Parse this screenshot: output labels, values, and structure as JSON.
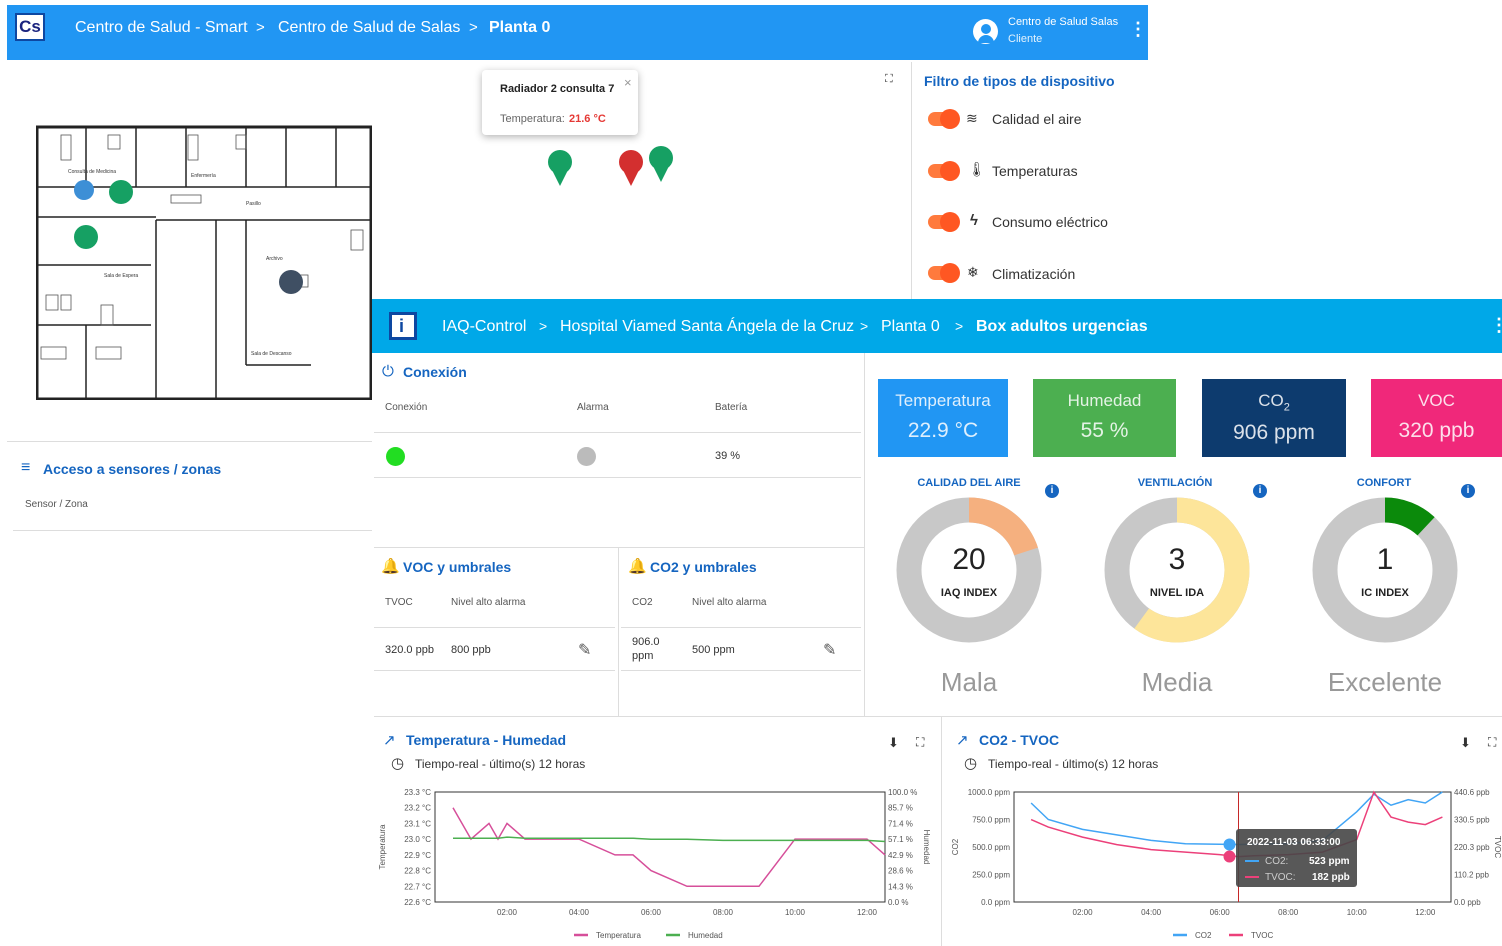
{
  "bg_app": {
    "logo": "Cs",
    "breadcrumbs": [
      "Centro de Salud - Smart",
      "Centro de Salud de Salas",
      "Planta 0"
    ],
    "separator": ">",
    "user_name": "Centro de Salud Salas",
    "user_role": "Cliente",
    "popup": {
      "title": "Radiador 2 consulta 7",
      "temp_label": "Temperatura:",
      "temp_value": "21.6 °C",
      "close": "×"
    },
    "filter_title": "Filtro de tipos de dispositivo",
    "filters": [
      {
        "label": "Calidad el aire",
        "icon": "wind-icon",
        "glyph": "≋"
      },
      {
        "label": "Temperaturas",
        "icon": "thermometer-icon",
        "glyph": "🌡"
      },
      {
        "label": "Consumo eléctrico",
        "icon": "lightning-icon",
        "glyph": "ϟ"
      },
      {
        "label": "Climatización",
        "icon": "snowflake-icon",
        "glyph": "❄"
      }
    ],
    "access_title": "Acceso a sensores / zonas",
    "access_sub": "Sensor / Zona"
  },
  "app": {
    "logo": "i",
    "breadcrumbs": [
      "IAQ-Control",
      "Hospital Viamed Santa Ángela de la Cruz",
      "Planta 0",
      "Box adultos urgencias"
    ],
    "separator": ">",
    "connection": {
      "title": "Conexión",
      "headers": [
        "Conexión",
        "Alarma",
        "Batería"
      ],
      "battery": "39 %",
      "conn_color": "#22dd22",
      "alarm_color": "#bbbbbb"
    },
    "voc": {
      "title": "VOC y umbrales",
      "h1": "TVOC",
      "h2": "Nivel alto alarma",
      "v1": "320.0 ppb",
      "v2": "800 ppb"
    },
    "co2": {
      "title": "CO2 y umbrales",
      "h1": "CO2",
      "h2": "Nivel alto alarma",
      "v1a": "906.0",
      "v1b": "ppm",
      "v2": "500 ppm"
    },
    "kpis": [
      {
        "label": "Temperatura",
        "value": "22.9 °C",
        "color": "#2196f3"
      },
      {
        "label": "Humedad",
        "value": "55 %",
        "color": "#4caf50"
      },
      {
        "label": "CO",
        "label_sub": "2",
        "value": "906 ppm",
        "color": "#0d3b6e"
      },
      {
        "label": "VOC",
        "value": "320 ppb",
        "color": "#f0287a"
      }
    ],
    "gauges": [
      {
        "title": "CALIDAD DEL AIRE",
        "value": "20",
        "sub": "IAQ INDEX",
        "word": "Mala",
        "color": "#f5b07f",
        "fraction": 0.2
      },
      {
        "title": "VENTILACIÓN",
        "value": "3",
        "sub": "NIVEL IDA",
        "word": "Media",
        "color": "#fde59a",
        "fraction": 0.6
      },
      {
        "title": "CONFORT",
        "value": "1",
        "sub": "IC INDEX",
        "word": "Excelente",
        "color": "#0b8a0b",
        "fraction": 0.12
      }
    ],
    "chart1": {
      "title": "Temperatura - Humedad",
      "sub": "Tiempo-real - último(s) 12 horas"
    },
    "chart2": {
      "title": "CO2 - TVOC",
      "sub": "Tiempo-real - último(s) 12 horas",
      "tooltip": {
        "time": "2022-11-03 06:33:00",
        "s1": "CO2:",
        "v1": "523 ppm",
        "s2": "TVOC:",
        "v2": "182 ppb"
      }
    }
  },
  "chart_data": [
    {
      "type": "line",
      "title": "Temperatura - Humedad",
      "x": [
        "00:30",
        "01:00",
        "01:30",
        "01:45",
        "02:00",
        "02:30",
        "03:00",
        "04:00",
        "05:00",
        "05:30",
        "06:00",
        "07:00",
        "08:00",
        "09:00",
        "10:00",
        "11:00",
        "12:00",
        "12:30"
      ],
      "xticks": [
        "02:00",
        "04:00",
        "06:00",
        "08:00",
        "10:00",
        "12:00"
      ],
      "ylabel": "Temperatura",
      "y2label": "Humedad",
      "yticks": [
        "23.3 °C",
        "23.2 °C",
        "23.1 °C",
        "23.0 °C",
        "22.9 °C",
        "22.8 °C",
        "22.7 °C",
        "22.6 °C"
      ],
      "y2ticks": [
        "100.0 %",
        "85.7 %",
        "71.4 %",
        "57.1 %",
        "42.9 %",
        "28.6 %",
        "14.3 %",
        "0.0 %"
      ],
      "ylim": [
        22.6,
        23.3
      ],
      "y2lim": [
        0,
        100
      ],
      "series": [
        {
          "name": "Temperatura",
          "color": "#d64f9a",
          "values": [
            23.2,
            23.0,
            23.1,
            23.0,
            23.1,
            23.0,
            23.0,
            23.0,
            22.9,
            22.9,
            22.8,
            22.7,
            22.7,
            22.7,
            23.0,
            23.0,
            23.0,
            22.9
          ]
        },
        {
          "name": "Humedad",
          "color": "#4caf50",
          "values": [
            58,
            58,
            58,
            58,
            59,
            58,
            58,
            58,
            58,
            58,
            57,
            57,
            56,
            56,
            56,
            56,
            56,
            55
          ]
        }
      ]
    },
    {
      "type": "line",
      "title": "CO2 - TVOC",
      "x": [
        "00:30",
        "01:00",
        "02:00",
        "03:00",
        "04:00",
        "05:00",
        "06:00",
        "06:33",
        "07:00",
        "08:00",
        "09:00",
        "10:00",
        "10:30",
        "11:00",
        "11:30",
        "12:00",
        "12:30"
      ],
      "xticks": [
        "02:00",
        "04:00",
        "06:00",
        "08:00",
        "10:00",
        "12:00"
      ],
      "ylabel": "CO2",
      "y2label": "TVOC",
      "yticks": [
        "1000.0 ppm",
        "750.0 ppm",
        "500.0 ppm",
        "250.0 ppm",
        "0.0 ppm"
      ],
      "y2ticks": [
        "440.6 ppb",
        "330.5 ppb",
        "220.3 ppb",
        "110.2 ppb",
        "0.0 ppb"
      ],
      "ylim": [
        0,
        1000
      ],
      "y2lim": [
        0,
        440.6
      ],
      "series": [
        {
          "name": "CO2",
          "color": "#42a5f5",
          "values": [
            900,
            750,
            660,
            610,
            560,
            530,
            525,
            523,
            525,
            530,
            560,
            820,
            980,
            880,
            930,
            900,
            1000
          ]
        },
        {
          "name": "TVOC",
          "color": "#ec407a",
          "values": [
            330,
            300,
            260,
            230,
            210,
            200,
            190,
            182,
            185,
            190,
            200,
            250,
            440,
            340,
            320,
            310,
            340
          ]
        }
      ]
    }
  ]
}
